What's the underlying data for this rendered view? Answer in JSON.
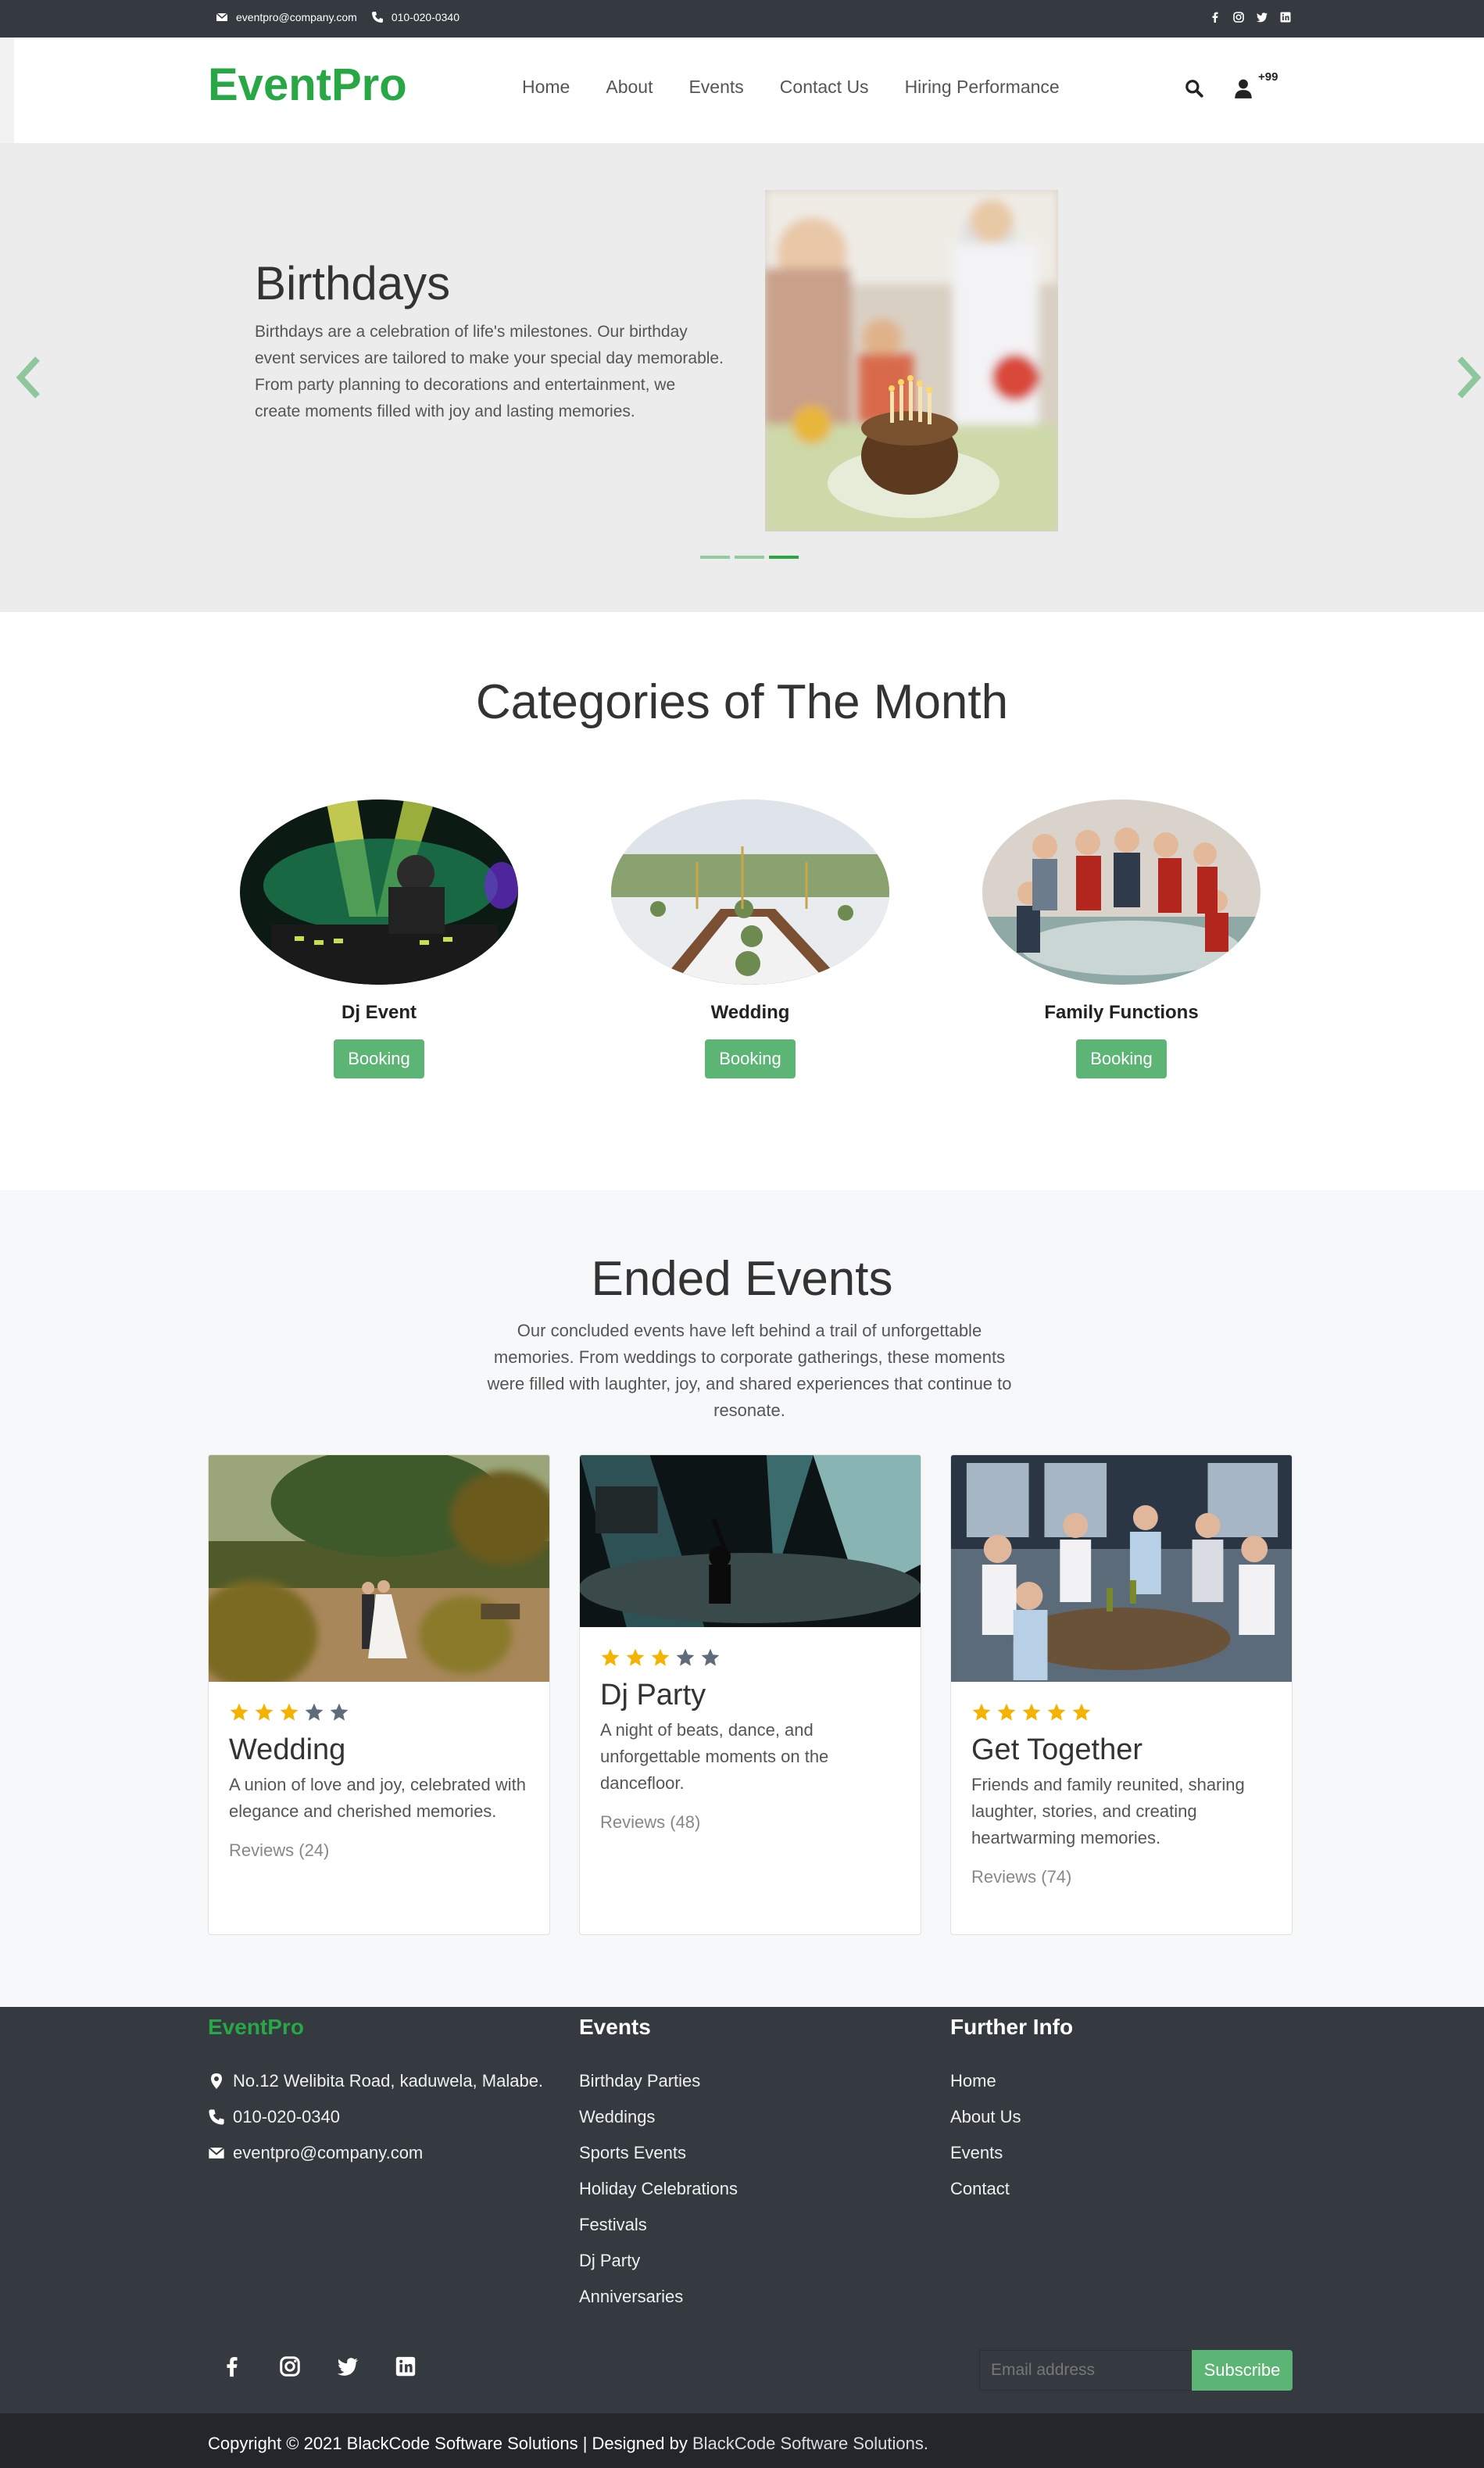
{
  "topbar": {
    "email": "eventpro@company.com",
    "phone": "010-020-0340",
    "social_icons": [
      "facebook-icon",
      "instagram-icon",
      "twitter-icon",
      "linkedin-icon"
    ]
  },
  "header": {
    "logo": "EventPro",
    "nav": [
      "Home",
      "About",
      "Events",
      "Contact Us",
      "Hiring Performance"
    ],
    "badge": "+99"
  },
  "hero": {
    "title": "Birthdays",
    "text": "Birthdays are a celebration of life's milestones. Our birthday event services are tailored to make your special day memorable. From party planning to decorations and entertainment, we create moments filled with joy and lasting memories.",
    "slides": 3,
    "active_slide": 3
  },
  "categories": {
    "title": "Categories of The Month",
    "items": [
      {
        "name": "Dj Event",
        "button": "Booking"
      },
      {
        "name": "Wedding",
        "button": "Booking"
      },
      {
        "name": "Family Functions",
        "button": "Booking"
      }
    ]
  },
  "ended": {
    "title": "Ended Events",
    "lead": "Our concluded events have left behind a trail of unforgettable memories. From weddings to corporate gatherings, these moments were filled with laughter, joy, and shared experiences that continue to resonate.",
    "cards": [
      {
        "title": "Wedding",
        "desc": "A union of love and joy, celebrated with elegance and cherished memories.",
        "reviews": "Reviews (24)",
        "rating": 3
      },
      {
        "title": "Dj Party",
        "desc": "A night of beats, dance, and unforgettable moments on the dancefloor.",
        "reviews": "Reviews (48)",
        "rating": 3
      },
      {
        "title": "Get Together",
        "desc": "Friends and family reunited, sharing laughter, stories, and creating heartwarming memories.",
        "reviews": "Reviews (74)",
        "rating": 5
      }
    ]
  },
  "footer": {
    "brand": "EventPro",
    "address": "No.12 Welibita Road, kaduwela, Malabe.",
    "phone": "010-020-0340",
    "email": "eventpro@company.com",
    "events_title": "Events",
    "events": [
      "Birthday Parties",
      "Weddings",
      "Sports Events",
      "Holiday Celebrations",
      "Festivals",
      "Dj Party",
      "Anniversaries"
    ],
    "info_title": "Further Info",
    "info": [
      "Home",
      "About Us",
      "Events",
      "Contact"
    ],
    "email_placeholder": "Email address",
    "subscribe": "Subscribe",
    "copyright": "Copyright © 2021 BlackCode Software Solutions | Designed by ",
    "copyright_link": "BlackCode Software Solutions."
  },
  "colors": {
    "accent": "#28a745",
    "button": "#5cb574",
    "dark": "#343a40",
    "star": "#f5b301",
    "star_off": "#5f6b7a"
  }
}
